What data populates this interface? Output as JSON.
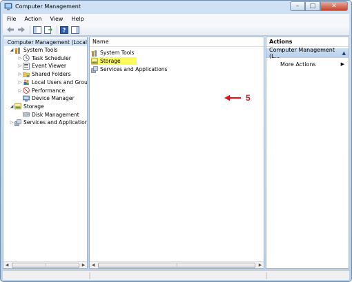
{
  "window": {
    "title": "Computer Management"
  },
  "caption_buttons": {
    "minimize": "–",
    "maximize": "□",
    "close": "✕"
  },
  "menu": [
    "File",
    "Action",
    "View",
    "Help"
  ],
  "toolbar": {
    "icons": [
      "back-arrow-icon",
      "forward-arrow-icon",
      "show-hide-tree-icon",
      "export-list-icon",
      "help-icon",
      "show-hide-action-pane-icon"
    ]
  },
  "tree": {
    "root": "Computer Management (Local",
    "items": [
      {
        "label": "System Tools",
        "icon": "tools-icon",
        "level": 1,
        "expander": "◢"
      },
      {
        "label": "Task Scheduler",
        "icon": "clock-icon",
        "level": 2,
        "expander": "▷"
      },
      {
        "label": "Event Viewer",
        "icon": "event-viewer-icon",
        "level": 2,
        "expander": "▷"
      },
      {
        "label": "Shared Folders",
        "icon": "shared-folder-icon",
        "level": 2,
        "expander": "▷"
      },
      {
        "label": "Local Users and Groups",
        "icon": "users-icon",
        "level": 2,
        "expander": "▷"
      },
      {
        "label": "Performance",
        "icon": "performance-icon",
        "level": 2,
        "expander": "▷"
      },
      {
        "label": "Device Manager",
        "icon": "device-manager-icon",
        "level": 2,
        "expander": ""
      },
      {
        "label": "Storage",
        "icon": "storage-icon",
        "level": 1,
        "expander": "◢"
      },
      {
        "label": "Disk Management",
        "icon": "disk-icon",
        "level": 2,
        "expander": ""
      },
      {
        "label": "Services and Applications",
        "icon": "services-icon",
        "level": 1,
        "expander": "▷"
      }
    ]
  },
  "list": {
    "header": "Name",
    "items": [
      {
        "label": "System Tools",
        "icon": "tools-icon",
        "highlighted": false
      },
      {
        "label": "Storage",
        "icon": "storage-icon",
        "highlighted": true
      },
      {
        "label": "Services and Applications",
        "icon": "services-icon",
        "highlighted": false
      }
    ]
  },
  "annotation": {
    "number": "5",
    "color": "#e0161b",
    "highlight_color": "#fbfb5a"
  },
  "actions": {
    "header": "Actions",
    "group": "Computer Management (L...",
    "group_chevron": "▲",
    "item": "More Actions",
    "item_arrow": "▶"
  },
  "scroll": {
    "left": "◀",
    "right": "▶",
    "grip": "⦙"
  }
}
